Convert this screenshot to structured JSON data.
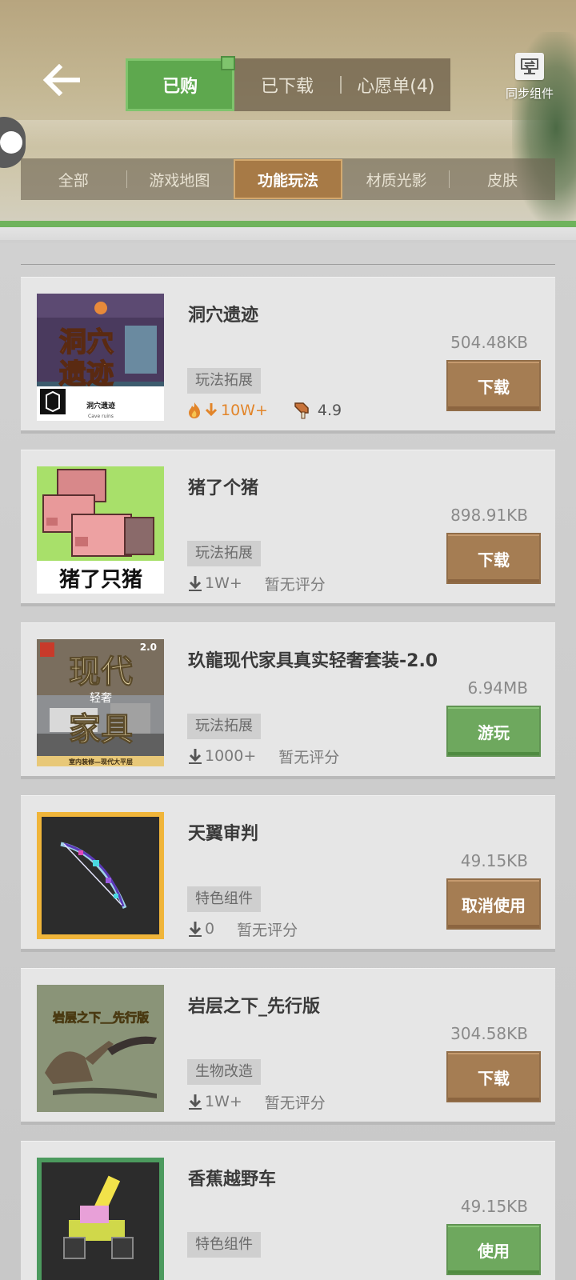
{
  "header": {
    "top_tabs": [
      "已购",
      "已下载",
      "心愿单(4)"
    ],
    "sync_label": "同步组件",
    "categories": [
      "全部",
      "游戏地图",
      "功能玩法",
      "材质光影",
      "皮肤"
    ]
  },
  "items": [
    {
      "title": "洞穴遗迹",
      "size": "504.48KB",
      "tag": "玩法拓展",
      "downloads": "10W+",
      "rating": "4.9",
      "action": "下载",
      "thumb_text": [
        "洞穴",
        "遗迹",
        "洞穴遗迹",
        "Cave ruins"
      ]
    },
    {
      "title": "猪了个猪",
      "size": "898.91KB",
      "tag": "玩法拓展",
      "downloads": "1W+",
      "rating": "暂无评分",
      "action": "下载",
      "thumb_text": [
        "猪了只猪"
      ]
    },
    {
      "title": "玖龍现代家具真实轻奢套装-2.0",
      "size": "6.94MB",
      "tag": "玩法拓展",
      "downloads": "1000+",
      "rating": "暂无评分",
      "action": "游玩",
      "thumb_text": [
        "现代",
        "轻奢",
        "家具",
        "2.0",
        "室内装修—现代大平层"
      ]
    },
    {
      "title": "天翼审判",
      "size": "49.15KB",
      "tag": "特色组件",
      "downloads": "0",
      "rating": "暂无评分",
      "action": "取消使用"
    },
    {
      "title": "岩层之下_先行版",
      "size": "304.58KB",
      "tag": "生物改造",
      "downloads": "1W+",
      "rating": "暂无评分",
      "action": "下载",
      "thumb_text": [
        "岩层之下＿先行版"
      ]
    },
    {
      "title": "香蕉越野车",
      "size": "49.15KB",
      "tag": "特色组件",
      "action": "使用"
    }
  ],
  "colors": {
    "brown_button": "#a57d53",
    "green_button": "#6ea85e",
    "hot_orange": "#e2852a"
  }
}
